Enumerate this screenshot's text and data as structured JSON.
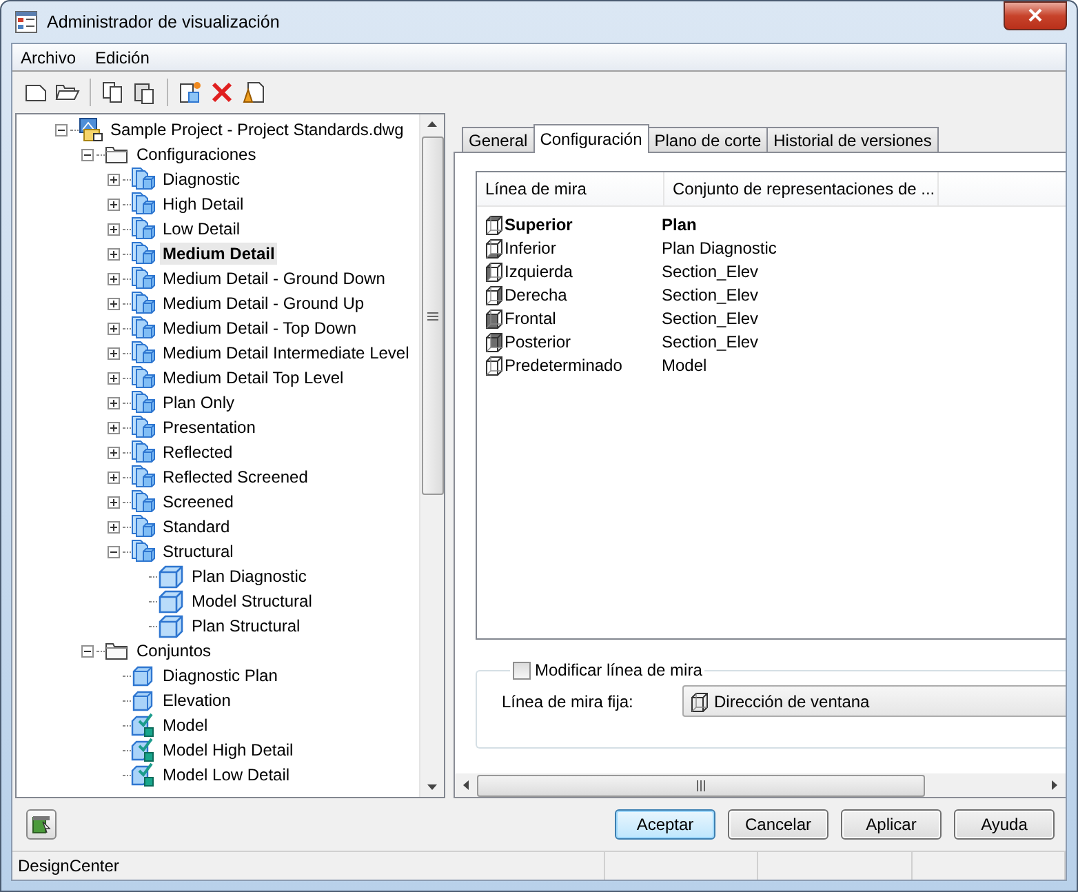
{
  "window": {
    "title": "Administrador de visualización"
  },
  "menu": [
    "Archivo",
    "Edición"
  ],
  "tree": [
    {
      "label": "Sample Project - Project Standards.dwg",
      "kind": "project",
      "expanded": true,
      "selected": false,
      "children": [
        {
          "label": "Configuraciones",
          "kind": "folder",
          "expanded": true,
          "selected": false,
          "children": [
            {
              "label": "Diagnostic",
              "kind": "configuration",
              "expanded": false,
              "selected": false
            },
            {
              "label": "High Detail",
              "kind": "configuration",
              "expanded": false,
              "selected": false
            },
            {
              "label": "Low Detail",
              "kind": "configuration",
              "expanded": false,
              "selected": false
            },
            {
              "label": "Medium Detail",
              "kind": "configuration",
              "expanded": false,
              "selected": true
            },
            {
              "label": "Medium Detail - Ground Down",
              "kind": "configuration",
              "expanded": false,
              "selected": false
            },
            {
              "label": "Medium Detail - Ground Up",
              "kind": "configuration",
              "expanded": false,
              "selected": false
            },
            {
              "label": "Medium Detail - Top Down",
              "kind": "configuration",
              "expanded": false,
              "selected": false
            },
            {
              "label": "Medium Detail Intermediate Level",
              "kind": "configuration",
              "expanded": false,
              "selected": false
            },
            {
              "label": "Medium Detail Top Level",
              "kind": "configuration",
              "expanded": false,
              "selected": false
            },
            {
              "label": "Plan Only",
              "kind": "configuration",
              "expanded": false,
              "selected": false
            },
            {
              "label": "Presentation",
              "kind": "configuration",
              "expanded": false,
              "selected": false
            },
            {
              "label": "Reflected",
              "kind": "configuration",
              "expanded": false,
              "selected": false
            },
            {
              "label": "Reflected Screened",
              "kind": "configuration",
              "expanded": false,
              "selected": false
            },
            {
              "label": "Screened",
              "kind": "configuration",
              "expanded": false,
              "selected": false
            },
            {
              "label": "Standard",
              "kind": "configuration",
              "expanded": false,
              "selected": false
            },
            {
              "label": "Structural",
              "kind": "configuration",
              "expanded": true,
              "selected": false,
              "children": [
                {
                  "label": "Plan Diagnostic",
                  "kind": "cube",
                  "selected": false
                },
                {
                  "label": "Model Structural",
                  "kind": "cube",
                  "selected": false
                },
                {
                  "label": "Plan Structural",
                  "kind": "cube",
                  "selected": false
                }
              ]
            }
          ]
        },
        {
          "label": "Conjuntos",
          "kind": "folder",
          "expanded": true,
          "selected": false,
          "children": [
            {
              "label": "Diagnostic Plan",
              "kind": "set",
              "selected": false
            },
            {
              "label": "Elevation",
              "kind": "set",
              "selected": false
            },
            {
              "label": "Model",
              "kind": "set-checked",
              "selected": false
            },
            {
              "label": "Model High Detail",
              "kind": "set-checked",
              "selected": false
            },
            {
              "label": "Model Low Detail",
              "kind": "set-checked",
              "selected": false
            }
          ]
        }
      ]
    }
  ],
  "tabs": [
    {
      "label": "General",
      "selected": false
    },
    {
      "label": "Configuración",
      "selected": true
    },
    {
      "label": "Plano de corte",
      "selected": false
    },
    {
      "label": "Historial de versiones",
      "selected": false
    }
  ],
  "table": {
    "columns": [
      "Línea de mira",
      "Conjunto de representaciones de ..."
    ],
    "rows": [
      {
        "view": "Superior",
        "kind": "top",
        "set": "Plan",
        "current": true
      },
      {
        "view": "Inferior",
        "kind": "bottom",
        "set": "Plan Diagnostic",
        "current": false
      },
      {
        "view": "Izquierda",
        "kind": "left",
        "set": "Section_Elev",
        "current": false
      },
      {
        "view": "Derecha",
        "kind": "right",
        "set": "Section_Elev",
        "current": false
      },
      {
        "view": "Frontal",
        "kind": "front",
        "set": "Section_Elev",
        "current": false
      },
      {
        "view": "Posterior",
        "kind": "back",
        "set": "Section_Elev",
        "current": false
      },
      {
        "view": "Predeterminado",
        "kind": "none",
        "set": "Model",
        "current": false
      }
    ]
  },
  "override": {
    "label": "Modificar línea de mira",
    "checked": false,
    "field_label": "Línea de mira fija:",
    "value": "Dirección de ventana"
  },
  "buttons": [
    {
      "label": "Aceptar",
      "default": true
    },
    {
      "label": "Cancelar",
      "default": false
    },
    {
      "label": "Aplicar",
      "default": false
    },
    {
      "label": "Ayuda",
      "default": false
    }
  ],
  "status_bar": [
    "DesignCenter"
  ]
}
